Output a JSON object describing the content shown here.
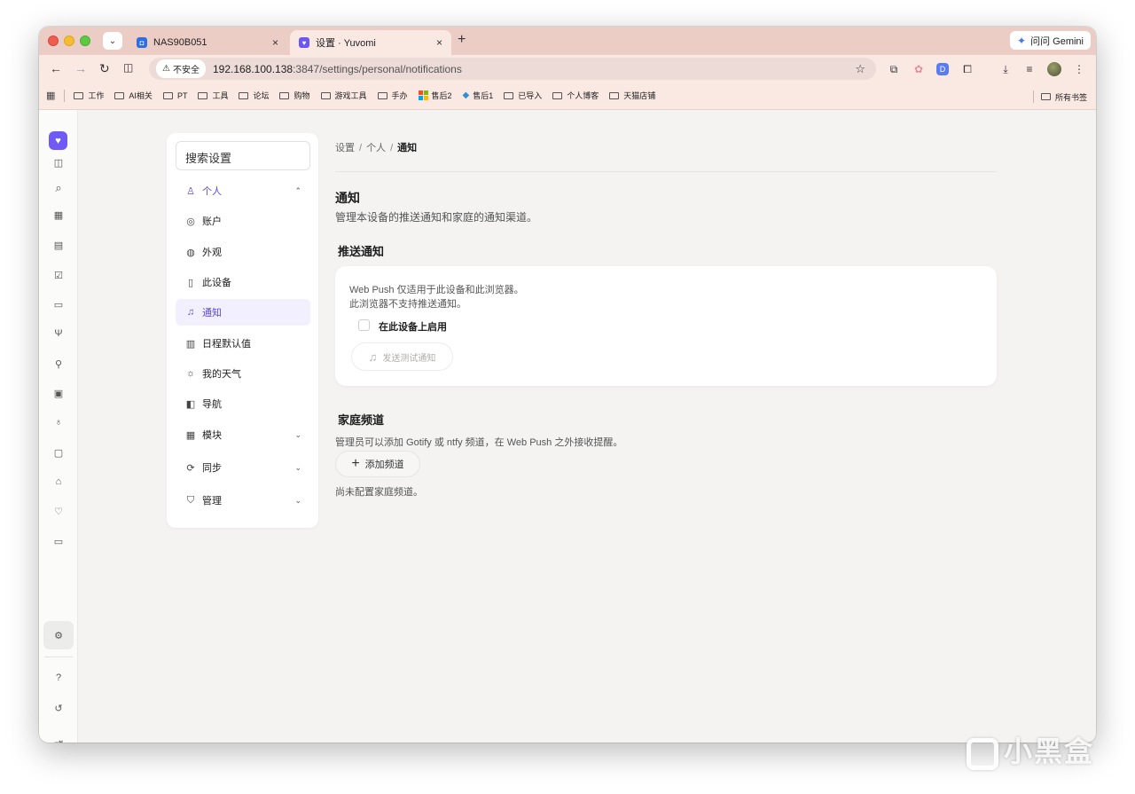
{
  "browser": {
    "tabs": [
      {
        "title": "NAS90B051",
        "close": "×"
      },
      {
        "title": "设置 · Yuvomi",
        "close": "×"
      }
    ],
    "new_tab": "+",
    "gemini_label": "问问 Gemini",
    "security_chip": "不安全",
    "url_host": "192.168.100.138",
    "url_path": ":3847/settings/personal/notifications",
    "bookmarks": [
      {
        "label": "工作",
        "type": "folder"
      },
      {
        "label": "AI相关",
        "type": "folder"
      },
      {
        "label": "PT",
        "type": "folder"
      },
      {
        "label": "工具",
        "type": "folder"
      },
      {
        "label": "论坛",
        "type": "folder"
      },
      {
        "label": "购物",
        "type": "folder"
      },
      {
        "label": "游戏工具",
        "type": "folder"
      },
      {
        "label": "手办",
        "type": "folder"
      },
      {
        "label": "售后2",
        "type": "site"
      },
      {
        "label": "售后1",
        "type": "site"
      },
      {
        "label": "已导入",
        "type": "folder"
      },
      {
        "label": "个人博客",
        "type": "folder"
      },
      {
        "label": "天猫店铺",
        "type": "folder"
      }
    ],
    "all_bookmarks": "所有书签"
  },
  "settings_nav": {
    "search_placeholder": "搜索设置",
    "items": [
      {
        "label": "个人",
        "icon": "user-icon",
        "chevron": "⌃"
      },
      {
        "label": "账户",
        "icon": "account-circle-icon"
      },
      {
        "label": "外观",
        "icon": "palette-icon"
      },
      {
        "label": "此设备",
        "icon": "device-icon"
      },
      {
        "label": "通知",
        "icon": "bell-icon"
      },
      {
        "label": "日程默认值",
        "icon": "calendar-clock-icon"
      },
      {
        "label": "我的天气",
        "icon": "weather-icon"
      },
      {
        "label": "导航",
        "icon": "sidebar-icon"
      },
      {
        "label": "模块",
        "icon": "grid-icon",
        "chevron": "⌄"
      },
      {
        "label": "同步",
        "icon": "sync-icon",
        "chevron": "⌄"
      },
      {
        "label": "管理",
        "icon": "shield-icon",
        "chevron": "⌄"
      }
    ]
  },
  "breadcrumb": [
    "设置",
    "个人",
    "通知"
  ],
  "page": {
    "title": "通知",
    "description": "管理本设备的推送通知和家庭的通知渠道。"
  },
  "push": {
    "title": "推送通知",
    "info_line1": "Web Push 仅适用于此设备和此浏览器。",
    "info_line2": "此浏览器不支持推送通知。",
    "checkbox_label": "在此设备上启用",
    "test_button": "发送测试通知"
  },
  "family": {
    "title": "家庭频道",
    "description": "管理员可以添加 Gotify 或 ntfy 频道，在 Web Push 之外接收提醒。",
    "add_button": "添加频道",
    "empty_text": "尚未配置家庭频道。"
  },
  "colors": {
    "accent": "#5b49e8",
    "tab_strip": "#eccdc5",
    "toolbar": "#fae8e3",
    "background": "#f4f3f2"
  },
  "watermark": "小黑盒"
}
